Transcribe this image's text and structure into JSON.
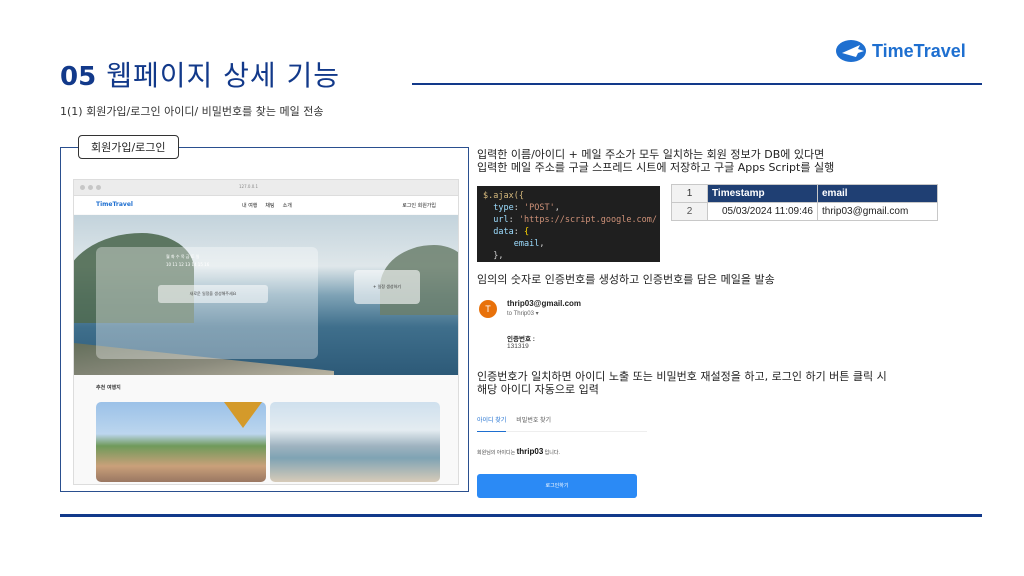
{
  "header": {
    "number": "05",
    "title": "웹페이지 상세 기능",
    "subtitle": "1(1) 회원가입/로그인 아이디/ 비밀번호를 찾는 메일 전송"
  },
  "logo": {
    "name": "TimeTravel",
    "icon": "airplane-icon",
    "color": "#1e6fd0"
  },
  "left_panel": {
    "tab_label": "회원가입/로그인",
    "screenshot": {
      "url": "127.0.0.1",
      "brand": "TimeTravel",
      "menu": [
        "내 여행",
        "채팅",
        "소개"
      ],
      "nav_right": "로그인 회원가입",
      "calendar_days": "월 화 수 목 금 토 일",
      "calendar_dates": "10 11 12 13 14 15 16",
      "schedule_button": "새로운 일정을 생성해주세요",
      "create_button": "+ 일정 생성하기",
      "recommend_label": "추천 여행지"
    }
  },
  "steps": {
    "step1": "입력한 이름/아이디 + 메일 주소가 모두 일치하는 회원 정보가 DB에 있다면\n입력한 메일 주소를 구글 스프레드 시트에 저장하고 구글 Apps Script를 실행",
    "step2": "임의의 숫자로 인증번호를 생성하고 인증번호를 담은 메일을 발송",
    "step3": "인증번호가 일치하면 아이디 노출 또는 비밀번호 재설정을 하고, 로그인 하기 버튼 클릭 시\n해당 아이디 자동으로 입력"
  },
  "code": {
    "line1": "$.ajax({",
    "type_key": "type",
    "type_val": "'POST'",
    "url_key": "url",
    "url_val": "'https://script.google.com/",
    "data_key": "data",
    "email": "email",
    "close": "},"
  },
  "sheet": {
    "columns": [
      "Timestamp",
      "email"
    ],
    "rows": [
      {
        "row_num": "1"
      },
      {
        "row_num": "2",
        "timestamp": "05/03/2024 11:09:46",
        "email": "thrip03@gmail.com"
      }
    ]
  },
  "mail": {
    "avatar": "T",
    "from": "thrip03@gmail.com",
    "to": "to Thrip03 ▾",
    "label": "인증번호 :",
    "value": "131319"
  },
  "find": {
    "tab_id": "아이디 찾기",
    "tab_pw": "비밀번호 찾기",
    "msg_prefix": "회원님의 아이디는",
    "user_id": "thrip03",
    "msg_suffix": "입니다.",
    "login_button": "로그인하기"
  },
  "colors": {
    "accent": "#12398a",
    "brand": "#1e6fd0",
    "sheet_header": "#1f3f73"
  }
}
